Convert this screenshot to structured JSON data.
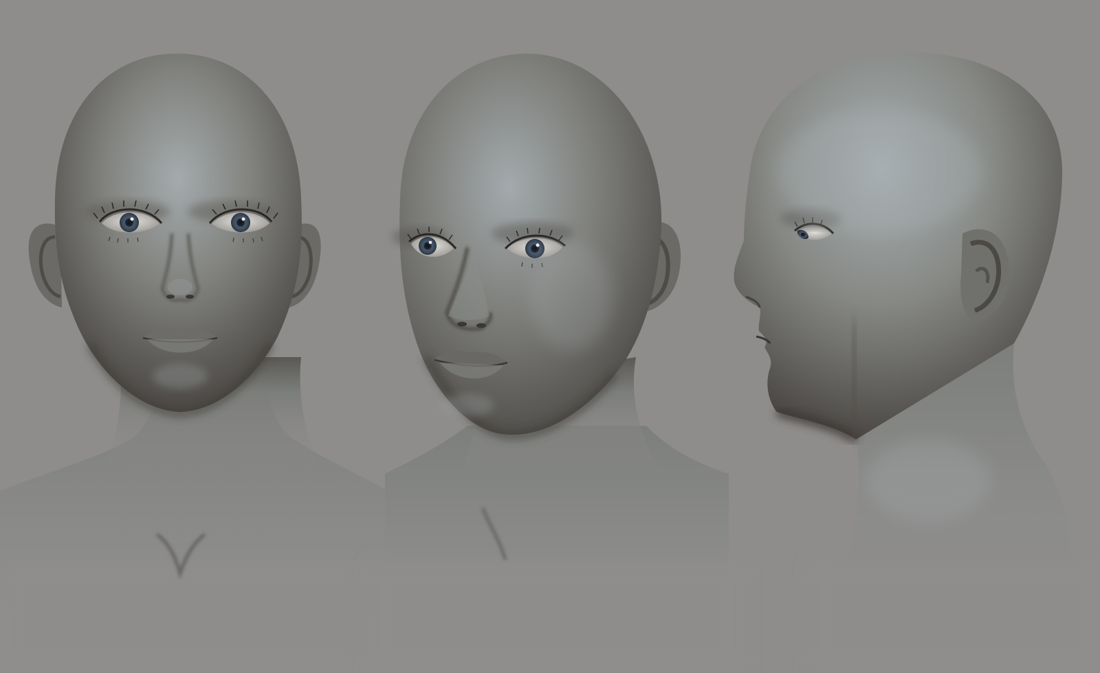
{
  "scene": {
    "background_color": "#8f8d8c",
    "skin_base_color": "#767773",
    "skin_highlight_color": "#a8b0b2",
    "skin_shadow_color": "#474441",
    "iris_color": "#3f4c5e",
    "sclera_color": "#d8d6d2",
    "views": [
      {
        "name": "front-view",
        "orientation": "front"
      },
      {
        "name": "three-quarter-view",
        "orientation": "three-quarter"
      },
      {
        "name": "profile-view",
        "orientation": "side"
      }
    ]
  }
}
